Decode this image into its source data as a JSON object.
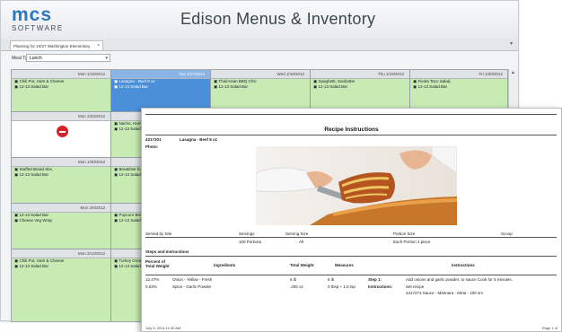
{
  "app": {
    "logo_main": "mcs",
    "logo_sub": "SOFTWARE",
    "title": "Edison Menus & Inventory"
  },
  "tabs": [
    {
      "label": "Planning for 10/27 Washington Elementary",
      "close": "×"
    }
  ],
  "filters": {
    "meal_type_label": "Meal Type",
    "meal_type_value": "Lunch"
  },
  "calendar": {
    "rows": [
      [
        {
          "date": "Mon 1/16/2012",
          "items": [
            "Chili Pot, Ham & Cheese",
            "12-13 Salad Bar"
          ]
        },
        {
          "date": "Tue 1/17/2012",
          "items": [
            "Lasagna - Beef 8 oz",
            "12-13 Salad Bar"
          ],
          "selected": true
        },
        {
          "date": "Wed 1/18/2012",
          "items": [
            "Thai/Asian BBQ Chic",
            "12-13 Salad Bar"
          ]
        },
        {
          "date": "Thu 1/19/2012",
          "items": [
            "Spaghetti, Sunbutter",
            "12-13 Salad Bar"
          ]
        },
        {
          "date": "Fri 1/20/2012",
          "items": [
            "Fiesta Taco Salad,",
            "12-13 Salad Bar"
          ]
        }
      ],
      [
        {
          "date": "Mon 1/23/2012",
          "items": [],
          "blocked": true
        },
        {
          "date": "",
          "items": [
            "Nacho, Ham",
            "12-13 Salad"
          ]
        }
      ],
      [
        {
          "date": "Mon 1/30/2012",
          "items": [
            "Stuffed Bread Stix,",
            "12-13 Salad Bar"
          ]
        },
        {
          "date": "",
          "items": [
            "Breakfast fo",
            "12-13 Salad"
          ]
        }
      ],
      [
        {
          "date": "Mon 2/6/2012",
          "items": [
            "12-13 Salad Bar",
            "Cheese Veg Wrap"
          ]
        },
        {
          "date": "",
          "items": [
            "Popcorn Bre",
            "12-13 Salad"
          ]
        }
      ],
      [
        {
          "date": "Mon 2/13/2012",
          "items": [
            "Chili Pot, Ham & Cheese",
            "12-13 Salad Bar"
          ]
        },
        {
          "date": "",
          "items": [
            "Turkey Grea",
            "12-13 Salad"
          ]
        }
      ]
    ]
  },
  "report": {
    "title": "Recipe Instructions",
    "recipe_id": "4317301",
    "recipe_name": "Lasagna - Beef 8 oz",
    "photo_label": "Photo:",
    "served_by": "Served by Site",
    "servings_label": "Servings",
    "serving_size_label": "Serving Size",
    "portion_size_label": "Portion Size",
    "scoop_label": "Scoop",
    "servings_value": "100 Portions",
    "serving_size_value": "All",
    "portion_size_value": "Each Portion 1 piece",
    "steps_heading": "Steps and Instructions",
    "columns": [
      "Percent of Total Weight",
      "Ingredients",
      "Total Weight",
      "Measures",
      "Instructions"
    ],
    "rows": [
      {
        "pct": "12.47%",
        "ingredient": "Onion - Yellow - Fresh",
        "weight": "6 lb",
        "measure": "6 lb",
        "step": "Step 1:",
        "instructions": "Add onions and garlic powder, to sauce Cook for 5 minutes."
      },
      {
        "pct": "0.03%",
        "ingredient": "Spice - Garlic Powder",
        "weight": ".205 oz",
        "measure": "0 tbsp + 1.5 tsp",
        "step": "Instructions:",
        "instructions": "Set recipe"
      },
      {
        "pct": "",
        "ingredient": "",
        "weight": "",
        "measure": "",
        "step": "",
        "instructions": "4317271  Sauce - Marinara - Meat - 100 srv"
      }
    ],
    "footer_left": "July 9, 2014 11:30 AM",
    "footer_right": "Page 1 of"
  },
  "colors": {
    "accent": "#2a77c4",
    "cell_green": "#c8ebb3",
    "cell_selected": "#4a8fd8",
    "blocked": "#d3232a"
  },
  "icons": [
    "close-icon",
    "chevron-down-icon",
    "no-entry-icon",
    "scroll-up-icon"
  ]
}
